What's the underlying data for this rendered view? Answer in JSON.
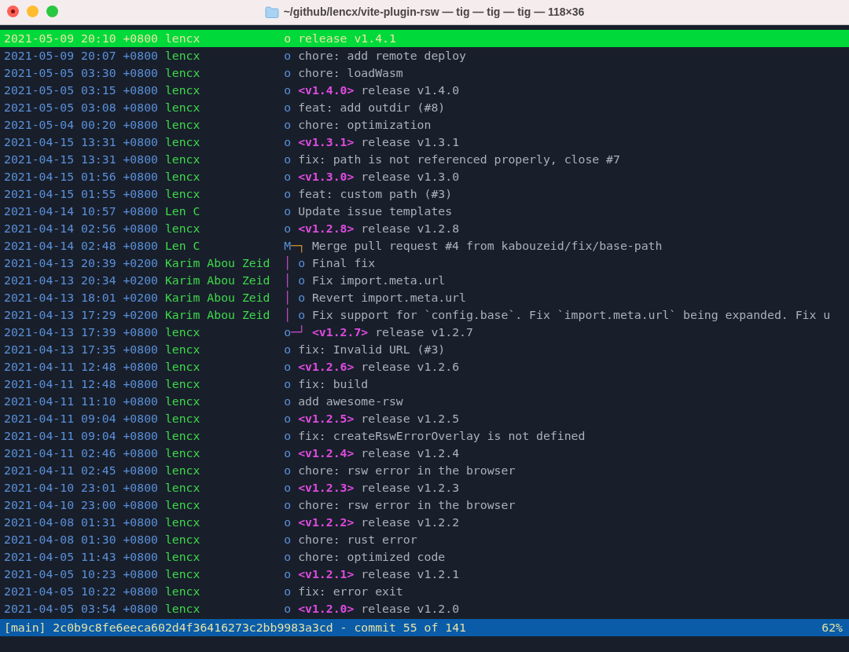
{
  "window": {
    "title": "~/github/lencx/vite-plugin-rsw — tig — tig — tig — 118×36"
  },
  "commits": [
    {
      "date": "2021-05-09 20:10 +0800",
      "author": "lencx",
      "graph": [
        {
          "text": "o",
          "kind": "node"
        }
      ],
      "message": "release v1.4.1",
      "selected": true
    },
    {
      "date": "2021-05-09 20:07 +0800",
      "author": "lencx",
      "graph": [
        {
          "text": "o",
          "kind": "node"
        }
      ],
      "message": "chore: add remote deploy",
      "selected": false
    },
    {
      "date": "2021-05-05 03:30 +0800",
      "author": "lencx",
      "graph": [
        {
          "text": "o",
          "kind": "node"
        }
      ],
      "message": "chore: loadWasm",
      "selected": false
    },
    {
      "date": "2021-05-05 03:15 +0800",
      "author": "lencx",
      "graph": [
        {
          "text": "o",
          "kind": "node"
        }
      ],
      "tag": "<v1.4.0>",
      "message": "release v1.4.0",
      "selected": false
    },
    {
      "date": "2021-05-05 03:08 +0800",
      "author": "lencx",
      "graph": [
        {
          "text": "o",
          "kind": "node"
        }
      ],
      "message": "feat: add outdir (#8)",
      "selected": false
    },
    {
      "date": "2021-05-04 00:20 +0800",
      "author": "lencx",
      "graph": [
        {
          "text": "o",
          "kind": "node"
        }
      ],
      "message": "chore: optimization",
      "selected": false
    },
    {
      "date": "2021-04-15 13:31 +0800",
      "author": "lencx",
      "graph": [
        {
          "text": "o",
          "kind": "node"
        }
      ],
      "tag": "<v1.3.1>",
      "message": "release v1.3.1",
      "selected": false
    },
    {
      "date": "2021-04-15 13:31 +0800",
      "author": "lencx",
      "graph": [
        {
          "text": "o",
          "kind": "node"
        }
      ],
      "message": "fix: path is not referenced properly, close #7",
      "selected": false
    },
    {
      "date": "2021-04-15 01:56 +0800",
      "author": "lencx",
      "graph": [
        {
          "text": "o",
          "kind": "node"
        }
      ],
      "tag": "<v1.3.0>",
      "message": "release v1.3.0",
      "selected": false
    },
    {
      "date": "2021-04-15 01:55 +0800",
      "author": "lencx",
      "graph": [
        {
          "text": "o",
          "kind": "node"
        }
      ],
      "message": "feat: custom path (#3)",
      "selected": false
    },
    {
      "date": "2021-04-14 10:57 +0800",
      "author": "Len C",
      "graph": [
        {
          "text": "o",
          "kind": "node"
        }
      ],
      "message": "Update issue templates",
      "selected": false
    },
    {
      "date": "2021-04-14 02:56 +0800",
      "author": "lencx",
      "graph": [
        {
          "text": "o",
          "kind": "node"
        }
      ],
      "tag": "<v1.2.8>",
      "message": "release v1.2.8",
      "selected": false
    },
    {
      "date": "2021-04-14 02:48 +0800",
      "author": "Len C",
      "graph": [
        {
          "text": "M",
          "kind": "node"
        },
        {
          "text": "─┐",
          "kind": "join"
        }
      ],
      "message": "Merge pull request #4 from kabouzeid/fix/base-path",
      "selected": false
    },
    {
      "date": "2021-04-13 20:39 +0200",
      "author": "Karim Abou Zeid",
      "graph": [
        {
          "text": "│",
          "kind": "branch"
        },
        {
          "text": " o",
          "kind": "node"
        }
      ],
      "message": "Final fix",
      "selected": false
    },
    {
      "date": "2021-04-13 20:34 +0200",
      "author": "Karim Abou Zeid",
      "graph": [
        {
          "text": "│",
          "kind": "branch"
        },
        {
          "text": " o",
          "kind": "node"
        }
      ],
      "message": "Fix import.meta.url",
      "selected": false
    },
    {
      "date": "2021-04-13 18:01 +0200",
      "author": "Karim Abou Zeid",
      "graph": [
        {
          "text": "│",
          "kind": "branch"
        },
        {
          "text": " o",
          "kind": "node"
        }
      ],
      "message": "Revert import.meta.url",
      "selected": false
    },
    {
      "date": "2021-04-13 17:29 +0200",
      "author": "Karim Abou Zeid",
      "graph": [
        {
          "text": "│",
          "kind": "branch"
        },
        {
          "text": " o",
          "kind": "node"
        }
      ],
      "message": "Fix support for `config.base`. Fix `import.meta.url` being expanded. Fix u",
      "selected": false
    },
    {
      "date": "2021-04-13 17:39 +0800",
      "author": "lencx",
      "graph": [
        {
          "text": "o",
          "kind": "node"
        },
        {
          "text": "─┘",
          "kind": "branch"
        }
      ],
      "tag": "<v1.2.7>",
      "message": "release v1.2.7",
      "selected": false
    },
    {
      "date": "2021-04-13 17:35 +0800",
      "author": "lencx",
      "graph": [
        {
          "text": "o",
          "kind": "node"
        }
      ],
      "message": "fix: Invalid URL (#3)",
      "selected": false
    },
    {
      "date": "2021-04-11 12:48 +0800",
      "author": "lencx",
      "graph": [
        {
          "text": "o",
          "kind": "node"
        }
      ],
      "tag": "<v1.2.6>",
      "message": "release v1.2.6",
      "selected": false
    },
    {
      "date": "2021-04-11 12:48 +0800",
      "author": "lencx",
      "graph": [
        {
          "text": "o",
          "kind": "node"
        }
      ],
      "message": "fix: build",
      "selected": false
    },
    {
      "date": "2021-04-11 11:10 +0800",
      "author": "lencx",
      "graph": [
        {
          "text": "o",
          "kind": "node"
        }
      ],
      "message": "add awesome-rsw",
      "selected": false
    },
    {
      "date": "2021-04-11 09:04 +0800",
      "author": "lencx",
      "graph": [
        {
          "text": "o",
          "kind": "node"
        }
      ],
      "tag": "<v1.2.5>",
      "message": "release v1.2.5",
      "selected": false
    },
    {
      "date": "2021-04-11 09:04 +0800",
      "author": "lencx",
      "graph": [
        {
          "text": "o",
          "kind": "node"
        }
      ],
      "message": "fix: createRswErrorOverlay is not defined",
      "selected": false
    },
    {
      "date": "2021-04-11 02:46 +0800",
      "author": "lencx",
      "graph": [
        {
          "text": "o",
          "kind": "node"
        }
      ],
      "tag": "<v1.2.4>",
      "message": "release v1.2.4",
      "selected": false
    },
    {
      "date": "2021-04-11 02:45 +0800",
      "author": "lencx",
      "graph": [
        {
          "text": "o",
          "kind": "node"
        }
      ],
      "message": "chore: rsw error in the browser",
      "selected": false
    },
    {
      "date": "2021-04-10 23:01 +0800",
      "author": "lencx",
      "graph": [
        {
          "text": "o",
          "kind": "node"
        }
      ],
      "tag": "<v1.2.3>",
      "message": "release v1.2.3",
      "selected": false
    },
    {
      "date": "2021-04-10 23:00 +0800",
      "author": "lencx",
      "graph": [
        {
          "text": "o",
          "kind": "node"
        }
      ],
      "message": "chore: rsw error in the browser",
      "selected": false
    },
    {
      "date": "2021-04-08 01:31 +0800",
      "author": "lencx",
      "graph": [
        {
          "text": "o",
          "kind": "node"
        }
      ],
      "tag": "<v1.2.2>",
      "message": "release v1.2.2",
      "selected": false
    },
    {
      "date": "2021-04-08 01:30 +0800",
      "author": "lencx",
      "graph": [
        {
          "text": "o",
          "kind": "node"
        }
      ],
      "message": "chore: rust error",
      "selected": false
    },
    {
      "date": "2021-04-05 11:43 +0800",
      "author": "lencx",
      "graph": [
        {
          "text": "o",
          "kind": "node"
        }
      ],
      "message": "chore: optimized code",
      "selected": false
    },
    {
      "date": "2021-04-05 10:23 +0800",
      "author": "lencx",
      "graph": [
        {
          "text": "o",
          "kind": "node"
        }
      ],
      "tag": "<v1.2.1>",
      "message": "release v1.2.1",
      "selected": false
    },
    {
      "date": "2021-04-05 10:22 +0800",
      "author": "lencx",
      "graph": [
        {
          "text": "o",
          "kind": "node"
        }
      ],
      "message": "fix: error exit",
      "selected": false
    },
    {
      "date": "2021-04-05 03:54 +0800",
      "author": "lencx",
      "graph": [
        {
          "text": "o",
          "kind": "node"
        }
      ],
      "tag": "<v1.2.0>",
      "message": "release v1.2.0",
      "selected": false
    }
  ],
  "status_bar": {
    "text": "[main] 2c0b9c8fe6eeca602d4f36416273c2bb9983a3cd - commit 55 of 141",
    "percent": "62%"
  }
}
